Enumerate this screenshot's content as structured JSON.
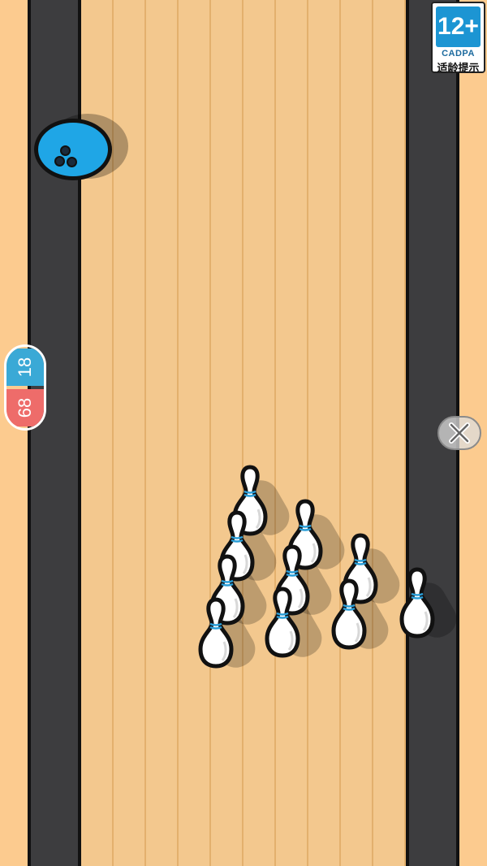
{
  "rating": {
    "age": "12+",
    "org": "CADPA",
    "label": "适龄提示"
  },
  "score": {
    "top_value": "18",
    "bottom_value": "68",
    "top_color": "#3aa9d6",
    "bottom_color": "#ee6c6a"
  },
  "ball": {
    "color": "#1fa6e6",
    "icon": "bowling-ball-icon"
  },
  "close": {
    "icon": "close-icon"
  },
  "pins": {
    "count": 10,
    "icon": "bowling-pin-icon"
  },
  "colors": {
    "lane": "#f3c88e",
    "gutter": "#3d3d3f",
    "background": "#fccb8f"
  }
}
